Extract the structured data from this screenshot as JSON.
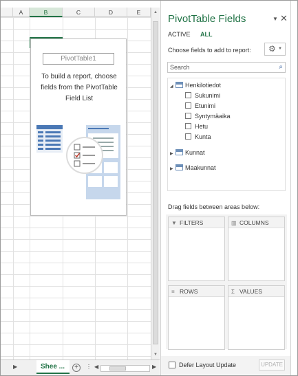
{
  "columns": [
    {
      "label": "A",
      "selected": false
    },
    {
      "label": "B",
      "selected": true
    },
    {
      "label": "C",
      "selected": false
    },
    {
      "label": "D",
      "selected": false
    },
    {
      "label": "E",
      "selected": false
    }
  ],
  "pivot_placeholder": {
    "name": "PivotTable1",
    "message": "To build a report, choose fields from the PivotTable Field List"
  },
  "sheet_tabs": {
    "active_tab": "Shee ...",
    "add_symbol": "+"
  },
  "pane": {
    "title": "PivotTable Fields",
    "tabs": {
      "active": "ACTIVE",
      "all": "ALL"
    },
    "choose_label": "Choose fields to add to report:",
    "search_placeholder": "Search",
    "tables": [
      {
        "name": "Henkilotiedot",
        "expanded": true,
        "fields": [
          "Sukunimi",
          "Etunimi",
          "Syntymäaika",
          "Hetu",
          "Kunta"
        ]
      },
      {
        "name": "Kunnat",
        "expanded": false,
        "fields": []
      },
      {
        "name": "Maakunnat",
        "expanded": false,
        "fields": []
      }
    ],
    "drag_label": "Drag fields between areas below:",
    "areas": {
      "filters": "FILTERS",
      "columns": "COLUMNS",
      "rows": "ROWS",
      "values": "VALUES"
    },
    "defer_label": "Defer Layout Update",
    "update_label": "UPDATE"
  },
  "icons": {
    "pane_menu": "chevron-down-icon",
    "close": "close-icon",
    "settings": "gear-icon",
    "search": "search-icon"
  },
  "colors": {
    "accent": "#217346",
    "search_icon": "#2b579a"
  }
}
